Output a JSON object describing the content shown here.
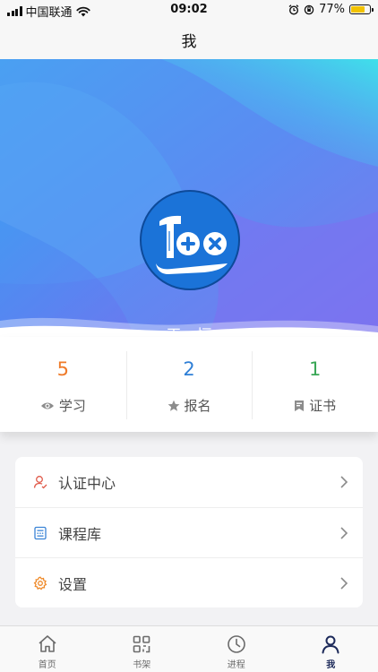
{
  "status_bar": {
    "carrier": "中国联通",
    "time": "09:02",
    "battery_text": "77%",
    "battery_level": 0.77
  },
  "nav": {
    "title": "我"
  },
  "profile": {
    "name": "王一恒",
    "avatar_icon": "tool-100-logo-icon"
  },
  "stats": [
    {
      "value": "5",
      "label": "学习",
      "color": "#ef7b2a",
      "icon": "eye-icon"
    },
    {
      "value": "2",
      "label": "报名",
      "color": "#2f7fd6",
      "icon": "star-icon"
    },
    {
      "value": "1",
      "label": "证书",
      "color": "#3aa756",
      "icon": "bookmark-icon"
    }
  ],
  "menu": [
    {
      "label": "认证中心",
      "icon": "user-cert-icon",
      "icon_color": "#e05a4a"
    },
    {
      "label": "课程库",
      "icon": "library-icon",
      "icon_color": "#3a83d6"
    },
    {
      "label": "设置",
      "icon": "gear-icon",
      "icon_color": "#ef8a2a"
    }
  ],
  "tabs": [
    {
      "label": "首页",
      "icon": "home-icon",
      "active": false
    },
    {
      "label": "书架",
      "icon": "grid-icon",
      "active": false
    },
    {
      "label": "进程",
      "icon": "clock-icon",
      "active": false
    },
    {
      "label": "我",
      "icon": "person-icon",
      "active": true
    }
  ]
}
